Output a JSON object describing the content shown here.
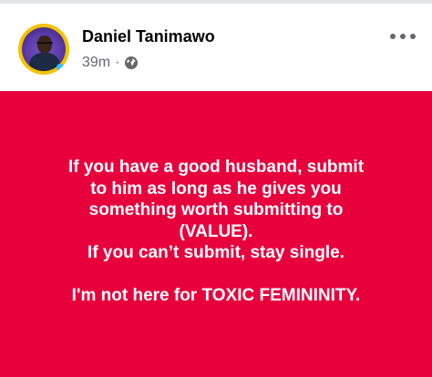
{
  "post": {
    "author_name": "Daniel Tanimawo",
    "timestamp": "39m",
    "separator": "·",
    "privacy_icon": "globe-icon",
    "more_icon": "more-options-icon",
    "background_color": "#e8003d",
    "text_color": "#ffffff",
    "lines": [
      "If you have a good husband, submit",
      "to him as long as he gives you",
      "something worth submitting to",
      "(VALUE).",
      "If you can’t submit, stay single.",
      "",
      "I'm not here for TOXIC FEMININITY."
    ]
  }
}
